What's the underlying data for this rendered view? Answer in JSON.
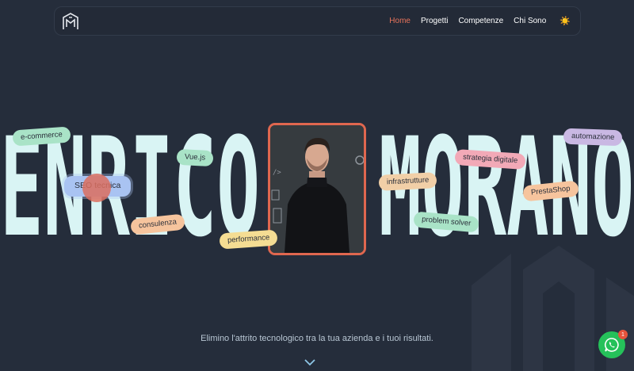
{
  "nav": {
    "logo_icon": "em-monogram-logo-icon",
    "links": [
      "Home",
      "Progetti",
      "Competenze",
      "Chi Sono"
    ],
    "active_link": "Home",
    "theme_toggle": "☀️"
  },
  "hero": {
    "first_name": "ENRICO",
    "last_name": "MORANO",
    "tagline": "Elimino l'attrito tecnologico tra la tua azienda e i tuoi risultati."
  },
  "tags": {
    "ecommerce": "e-commerce",
    "vuejs": "Vue.js",
    "seo": "SEO tecnica",
    "consulenza": "consulenza",
    "performance": "performance",
    "infrastrutture": "infrastrutture",
    "problem_solver": "problem solver",
    "strategia": "strategia digitale",
    "prestashop": "PrestaShop",
    "automazione": "automazione"
  },
  "whatsapp": {
    "icon": "whatsapp-icon",
    "badge_count": "1"
  },
  "colors": {
    "background": "#252d3b",
    "letters": "#d9f4f4",
    "accent": "#e8735a",
    "photo_border": "#e0674f",
    "whatsapp": "#25c15a"
  }
}
